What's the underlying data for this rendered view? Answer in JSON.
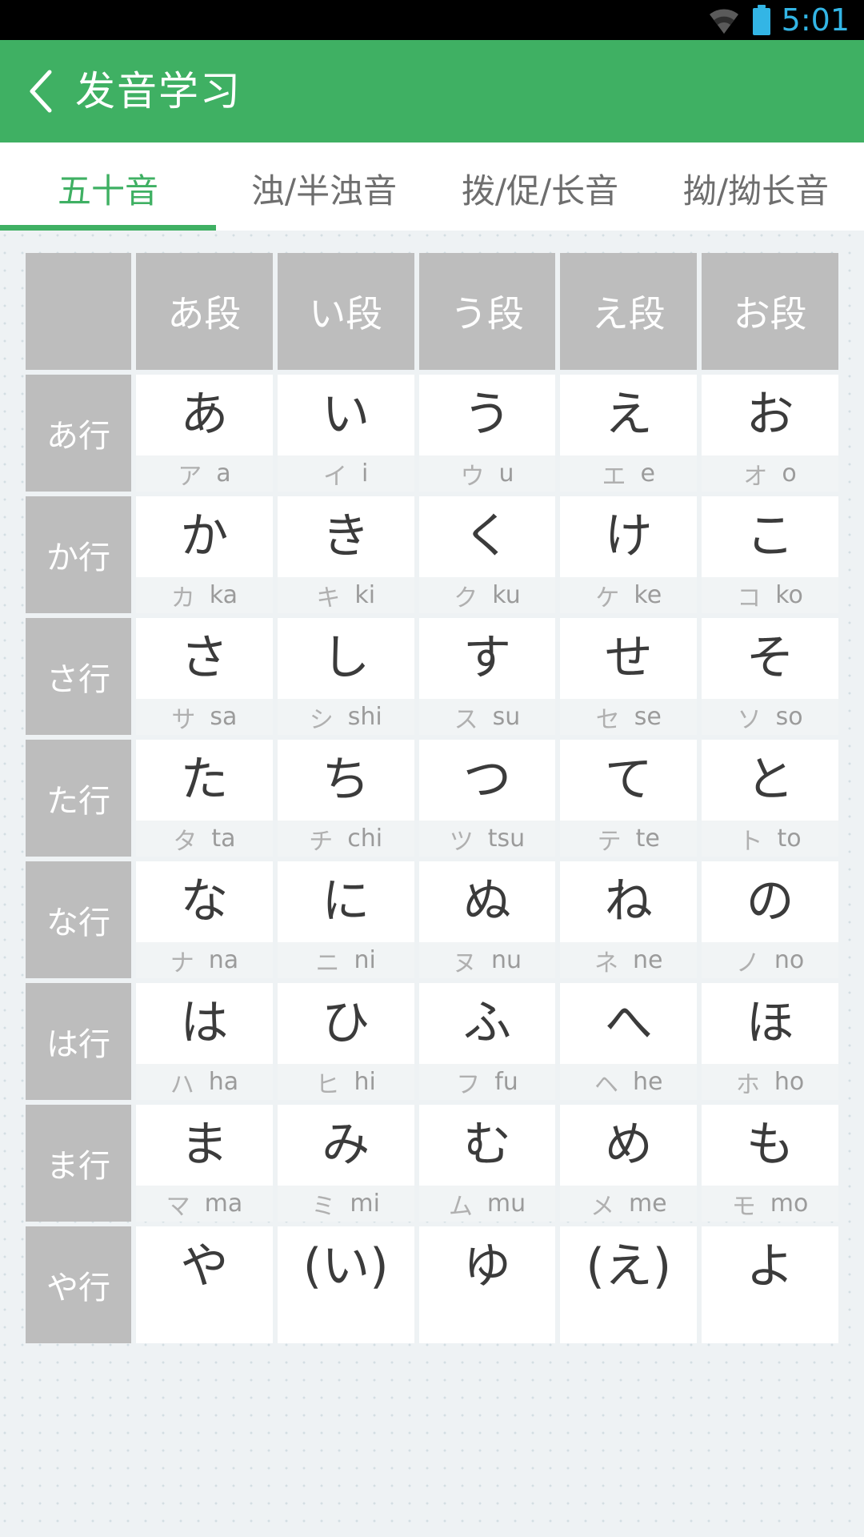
{
  "status_bar": {
    "time": "5:01",
    "wifi_icon": "wifi-icon",
    "battery_icon": "battery-icon",
    "accent_color": "#33b5e5"
  },
  "app_bar": {
    "back_icon": "back-chevron-icon",
    "title": "发音学习",
    "background_color": "#3fb063",
    "text_color": "#ffffff"
  },
  "tabs": {
    "active_index": 0,
    "active_color": "#3fb063",
    "inactive_color": "#6e6e6e",
    "items": [
      {
        "label": "五十音"
      },
      {
        "label": "浊/半浊音"
      },
      {
        "label": "拨/促/长音"
      },
      {
        "label": "拗/拗长音"
      }
    ]
  },
  "table": {
    "corner_label": "",
    "column_headers": [
      "あ段",
      "い段",
      "う段",
      "え段",
      "お段"
    ],
    "rows": [
      {
        "label": "あ行",
        "cells": [
          {
            "kana": "あ",
            "kata": "ア",
            "romaji": "a"
          },
          {
            "kana": "い",
            "kata": "イ",
            "romaji": "i"
          },
          {
            "kana": "う",
            "kata": "ウ",
            "romaji": "u"
          },
          {
            "kana": "え",
            "kata": "エ",
            "romaji": "e"
          },
          {
            "kana": "お",
            "kata": "オ",
            "romaji": "o"
          }
        ]
      },
      {
        "label": "か行",
        "cells": [
          {
            "kana": "か",
            "kata": "カ",
            "romaji": "ka"
          },
          {
            "kana": "き",
            "kata": "キ",
            "romaji": "ki"
          },
          {
            "kana": "く",
            "kata": "ク",
            "romaji": "ku"
          },
          {
            "kana": "け",
            "kata": "ケ",
            "romaji": "ke"
          },
          {
            "kana": "こ",
            "kata": "コ",
            "romaji": "ko"
          }
        ]
      },
      {
        "label": "さ行",
        "cells": [
          {
            "kana": "さ",
            "kata": "サ",
            "romaji": "sa"
          },
          {
            "kana": "し",
            "kata": "シ",
            "romaji": "shi"
          },
          {
            "kana": "す",
            "kata": "ス",
            "romaji": "su"
          },
          {
            "kana": "せ",
            "kata": "セ",
            "romaji": "se"
          },
          {
            "kana": "そ",
            "kata": "ソ",
            "romaji": "so"
          }
        ]
      },
      {
        "label": "た行",
        "cells": [
          {
            "kana": "た",
            "kata": "タ",
            "romaji": "ta"
          },
          {
            "kana": "ち",
            "kata": "チ",
            "romaji": "chi"
          },
          {
            "kana": "つ",
            "kata": "ツ",
            "romaji": "tsu"
          },
          {
            "kana": "て",
            "kata": "テ",
            "romaji": "te"
          },
          {
            "kana": "と",
            "kata": "ト",
            "romaji": "to"
          }
        ]
      },
      {
        "label": "な行",
        "cells": [
          {
            "kana": "な",
            "kata": "ナ",
            "romaji": "na"
          },
          {
            "kana": "に",
            "kata": "ニ",
            "romaji": "ni"
          },
          {
            "kana": "ぬ",
            "kata": "ヌ",
            "romaji": "nu"
          },
          {
            "kana": "ね",
            "kata": "ネ",
            "romaji": "ne"
          },
          {
            "kana": "の",
            "kata": "ノ",
            "romaji": "no"
          }
        ]
      },
      {
        "label": "は行",
        "cells": [
          {
            "kana": "は",
            "kata": "ハ",
            "romaji": "ha"
          },
          {
            "kana": "ひ",
            "kata": "ヒ",
            "romaji": "hi"
          },
          {
            "kana": "ふ",
            "kata": "フ",
            "romaji": "fu"
          },
          {
            "kana": "へ",
            "kata": "ヘ",
            "romaji": "he"
          },
          {
            "kana": "ほ",
            "kata": "ホ",
            "romaji": "ho"
          }
        ]
      },
      {
        "label": "ま行",
        "cells": [
          {
            "kana": "ま",
            "kata": "マ",
            "romaji": "ma"
          },
          {
            "kana": "み",
            "kata": "ミ",
            "romaji": "mi"
          },
          {
            "kana": "む",
            "kata": "ム",
            "romaji": "mu"
          },
          {
            "kana": "め",
            "kata": "メ",
            "romaji": "me"
          },
          {
            "kana": "も",
            "kata": "モ",
            "romaji": "mo"
          }
        ]
      },
      {
        "label": "や行",
        "cells": [
          {
            "kana": "や",
            "kata": "",
            "romaji": ""
          },
          {
            "kana": "(い)",
            "kata": "",
            "romaji": ""
          },
          {
            "kana": "ゆ",
            "kata": "",
            "romaji": ""
          },
          {
            "kana": "(え)",
            "kata": "",
            "romaji": ""
          },
          {
            "kana": "よ",
            "kata": "",
            "romaji": ""
          }
        ]
      }
    ]
  }
}
